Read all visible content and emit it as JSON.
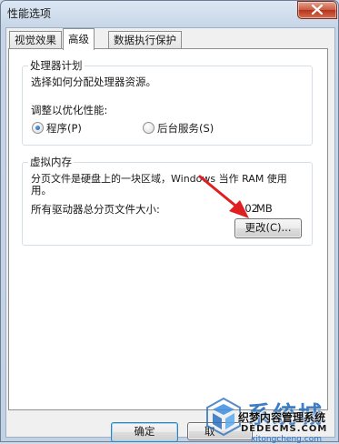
{
  "window": {
    "title": "性能选项"
  },
  "tabs": [
    {
      "label": "视觉效果",
      "active": false
    },
    {
      "label": "高级",
      "active": true
    },
    {
      "label": "数据执行保护",
      "active": false
    }
  ],
  "processor": {
    "group_title": "处理器计划",
    "description": "选择如何分配处理器资源。",
    "adjust_label": "调整以优化性能:",
    "options": [
      {
        "label": "程序(P)",
        "selected": true
      },
      {
        "label": "后台服务(S)",
        "selected": false
      }
    ]
  },
  "virtual_memory": {
    "group_title": "虚拟内存",
    "description_line1": "分页文件是硬盘上的一块区域，Windows 当作 RAM 使用",
    "description_line2": "用。",
    "total_label": "所有驱动器总分页文件大小:",
    "total_value": "102",
    "total_unit": "MB",
    "change_button": "更改(C)..."
  },
  "footer": {
    "ok_button": "确定",
    "cancel_button": "取"
  },
  "watermark": {
    "brand_big": "系统城",
    "line1": "织梦内容管理系统",
    "line2": "DEDECMS.COM",
    "line3": "xitongcheng.com"
  },
  "colors": {
    "arrow": "#e02020",
    "accent": "#2a6fbf"
  }
}
